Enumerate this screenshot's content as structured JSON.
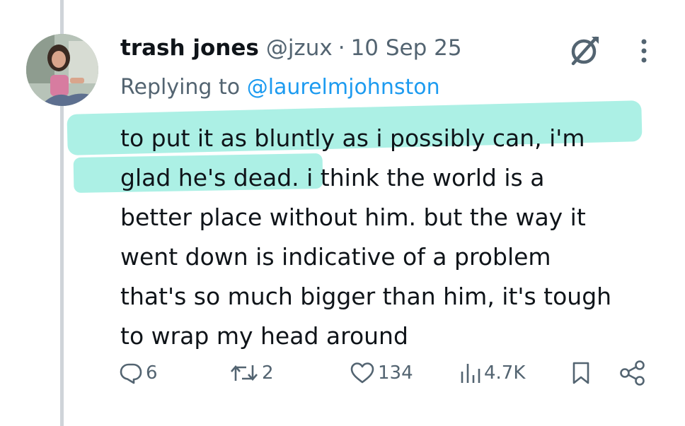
{
  "tweet": {
    "author_name": "trash jones",
    "handle": "@jzux",
    "separator": "·",
    "date": "10 Sep 25",
    "replying_prefix": "Replying to",
    "replying_to": "@laurelmjohnston",
    "body_lines": [
      "to put it as bluntly as i possibly can, i'm",
      "glad he's dead.",
      " i think the world is a",
      "better place without him. but the way it",
      "went down is indicative of a problem",
      "that's so much bigger than him, it's tough",
      "to wrap my head around"
    ]
  },
  "actions": {
    "replies": "6",
    "reposts": "2",
    "likes": "134",
    "views": "4.7K"
  },
  "colors": {
    "highlight": "#a8efe4",
    "mention": "#1d9bf0",
    "secondary_text": "#536471"
  },
  "icons": [
    "grok-icon",
    "more-icon",
    "reply-icon",
    "repost-icon",
    "like-icon",
    "views-icon",
    "bookmark-icon",
    "share-icon"
  ]
}
